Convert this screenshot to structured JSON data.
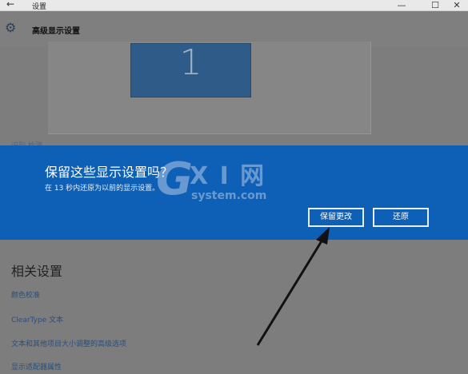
{
  "window": {
    "title": "设置",
    "back_icon": "back-arrow-icon",
    "minimize": "—",
    "maximize": "☐",
    "close": "✕"
  },
  "header": {
    "icon": "gear-icon",
    "title": "高级显示设置"
  },
  "preview": {
    "monitor_label": "1",
    "partial_links": "识别   检测"
  },
  "dialog": {
    "heading": "保留这些显示设置吗？",
    "subtext": "在 13 秒内还原为以前的显示设置。",
    "keep_button": "保留更改",
    "revert_button": "还原",
    "background_color": "#0e60b6"
  },
  "watermark": {
    "logo": "G",
    "text": "X I 网",
    "domain": "system.com"
  },
  "related": {
    "title": "相关设置",
    "links": [
      "颜色校准",
      "ClearType 文本",
      "文本和其他项目大小调整的高级选项",
      "显示适配器属性"
    ]
  }
}
